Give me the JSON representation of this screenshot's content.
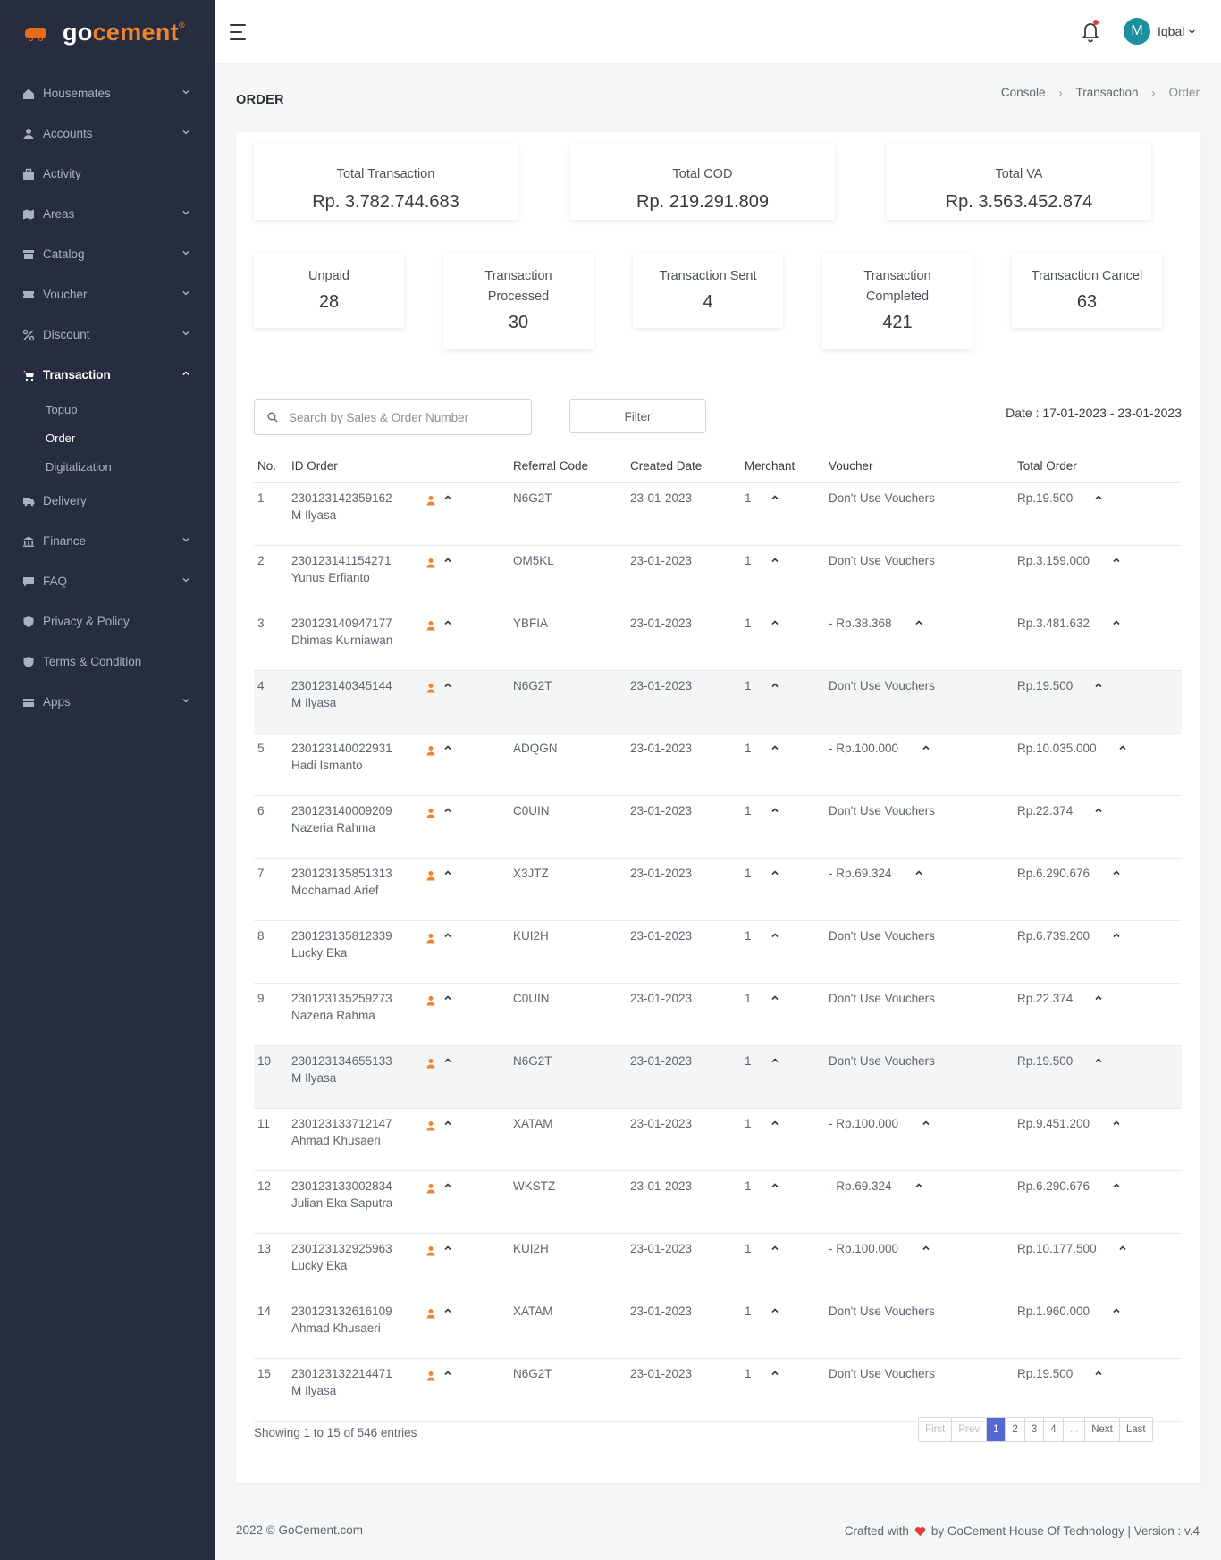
{
  "brand": {
    "go": "go",
    "cement": "cement",
    "reg": "®"
  },
  "sidebar": {
    "items": [
      {
        "label": "Housemates",
        "icon": "home-icon",
        "chevron": true
      },
      {
        "label": "Accounts",
        "icon": "user-icon",
        "chevron": true
      },
      {
        "label": "Activity",
        "icon": "briefcase-icon",
        "chevron": false
      },
      {
        "label": "Areas",
        "icon": "map-icon",
        "chevron": true
      },
      {
        "label": "Catalog",
        "icon": "catalog-icon",
        "chevron": true
      },
      {
        "label": "Voucher",
        "icon": "ticket-icon",
        "chevron": true
      },
      {
        "label": "Discount",
        "icon": "percent-icon",
        "chevron": true
      },
      {
        "label": "Transaction",
        "icon": "cart-icon",
        "chevron": true,
        "expanded": true
      },
      {
        "label": "Delivery",
        "icon": "truck-icon",
        "chevron": false
      },
      {
        "label": "Finance",
        "icon": "bank-icon",
        "chevron": true
      },
      {
        "label": "FAQ",
        "icon": "chat-icon",
        "chevron": true
      },
      {
        "label": "Privacy & Policy",
        "icon": "shield-icon",
        "chevron": false
      },
      {
        "label": "Terms & Condition",
        "icon": "shield-icon",
        "chevron": false
      },
      {
        "label": "Apps",
        "icon": "apps-icon",
        "chevron": true
      }
    ],
    "sub_items": [
      {
        "label": "Topup"
      },
      {
        "label": "Order"
      },
      {
        "label": "Digitalization"
      }
    ]
  },
  "topbar": {
    "user_initial": "M",
    "user_name": "Iqbal"
  },
  "page": {
    "title": "ORDER"
  },
  "breadcrumb": {
    "console": "Console",
    "transaction": "Transaction",
    "order": "Order",
    "sep": "›"
  },
  "stats_top": [
    {
      "label": "Total Transaction",
      "value": "Rp. 3.782.744.683"
    },
    {
      "label": "Total COD",
      "value": "Rp. 219.291.809"
    },
    {
      "label": "Total VA",
      "value": "Rp. 3.563.452.874"
    }
  ],
  "stats_bottom": [
    {
      "label": "Unpaid",
      "value": "28"
    },
    {
      "label": "Transaction Processed",
      "value": "30"
    },
    {
      "label": "Transaction Sent",
      "value": "4"
    },
    {
      "label": "Transaction Completed",
      "value": "421"
    },
    {
      "label": "Transaction Cancel",
      "value": "63"
    }
  ],
  "toolbar": {
    "search_placeholder": "Search by Sales & Order Number",
    "filter_label": "Filter",
    "date_range": "Date : 17-01-2023 - 23-01-2023"
  },
  "table": {
    "headers": {
      "no": "No.",
      "id": "ID Order",
      "ref": "Referral Code",
      "date": "Created Date",
      "merchant": "Merchant",
      "voucher": "Voucher",
      "total": "Total Order"
    },
    "rows": [
      {
        "no": "1",
        "id": "230123142359162",
        "name": "M Ilyasa",
        "ref": "N6G2T",
        "date": "23-01-2023",
        "merchant": "1",
        "voucher": "Don't Use Vouchers",
        "total": "Rp.19.500"
      },
      {
        "no": "2",
        "id": "230123141154271",
        "name": "Yunus Erfianto",
        "ref": "OM5KL",
        "date": "23-01-2023",
        "merchant": "1",
        "voucher": "Don't Use Vouchers",
        "total": "Rp.3.159.000"
      },
      {
        "no": "3",
        "id": "230123140947177",
        "name": "Dhimas Kurniawan",
        "ref": "YBFIA",
        "date": "23-01-2023",
        "merchant": "1",
        "voucher": "- Rp.38.368",
        "total": "Rp.3.481.632"
      },
      {
        "no": "4",
        "id": "230123140345144",
        "name": "M Ilyasa",
        "ref": "N6G2T",
        "date": "23-01-2023",
        "merchant": "1",
        "voucher": "Don't Use Vouchers",
        "total": "Rp.19.500"
      },
      {
        "no": "5",
        "id": "230123140022931",
        "name": "Hadi Ismanto",
        "ref": "ADQGN",
        "date": "23-01-2023",
        "merchant": "1",
        "voucher": "- Rp.100.000",
        "total": "Rp.10.035.000"
      },
      {
        "no": "6",
        "id": "230123140009209",
        "name": "Nazeria Rahma",
        "ref": "C0UIN",
        "date": "23-01-2023",
        "merchant": "1",
        "voucher": "Don't Use Vouchers",
        "total": "Rp.22.374"
      },
      {
        "no": "7",
        "id": "230123135851313",
        "name": "Mochamad Arief",
        "ref": "X3JTZ",
        "date": "23-01-2023",
        "merchant": "1",
        "voucher": "- Rp.69.324",
        "total": "Rp.6.290.676"
      },
      {
        "no": "8",
        "id": "230123135812339",
        "name": "Lucky Eka",
        "ref": "KUI2H",
        "date": "23-01-2023",
        "merchant": "1",
        "voucher": "Don't Use Vouchers",
        "total": "Rp.6.739.200"
      },
      {
        "no": "9",
        "id": "230123135259273",
        "name": "Nazeria Rahma",
        "ref": "C0UIN",
        "date": "23-01-2023",
        "merchant": "1",
        "voucher": "Don't Use Vouchers",
        "total": "Rp.22.374"
      },
      {
        "no": "10",
        "id": "230123134655133",
        "name": "M Ilyasa",
        "ref": "N6G2T",
        "date": "23-01-2023",
        "merchant": "1",
        "voucher": "Don't Use Vouchers",
        "total": "Rp.19.500"
      },
      {
        "no": "11",
        "id": "230123133712147",
        "name": "Ahmad Khusaeri",
        "ref": "XATAM",
        "date": "23-01-2023",
        "merchant": "1",
        "voucher": "- Rp.100.000",
        "total": "Rp.9.451.200"
      },
      {
        "no": "12",
        "id": "230123133002834",
        "name": "Julian Eka Saputra",
        "ref": "WKSTZ",
        "date": "23-01-2023",
        "merchant": "1",
        "voucher": "- Rp.69.324",
        "total": "Rp.6.290.676"
      },
      {
        "no": "13",
        "id": "230123132925963",
        "name": "Lucky Eka",
        "ref": "KUI2H",
        "date": "23-01-2023",
        "merchant": "1",
        "voucher": "- Rp.100.000",
        "total": "Rp.10.177.500"
      },
      {
        "no": "14",
        "id": "230123132616109",
        "name": "Ahmad Khusaeri",
        "ref": "XATAM",
        "date": "23-01-2023",
        "merchant": "1",
        "voucher": "Don't Use Vouchers",
        "total": "Rp.1.960.000"
      },
      {
        "no": "15",
        "id": "230123132214471",
        "name": "M Ilyasa",
        "ref": "N6G2T",
        "date": "23-01-2023",
        "merchant": "1",
        "voucher": "Don't Use Vouchers",
        "total": "Rp.19.500"
      }
    ]
  },
  "pagination": {
    "showing": "Showing 1 to 15 of 546 entries",
    "first": "First",
    "prev": "Prev",
    "pages": [
      "1",
      "2",
      "3",
      "4"
    ],
    "ellipsis": "...",
    "next": "Next",
    "last": "Last"
  },
  "footer": {
    "copyright": "2022 © GoCement.com",
    "crafted_prefix": "Crafted with",
    "crafted_suffix": "by GoCement House Of Technology | Version : v.4"
  },
  "colors": {
    "sidebar": "#272d3e",
    "accent": "#f0842e",
    "pager_active": "#5569d6",
    "avatar": "#1a8f9e",
    "heart": "#e53a3a"
  }
}
